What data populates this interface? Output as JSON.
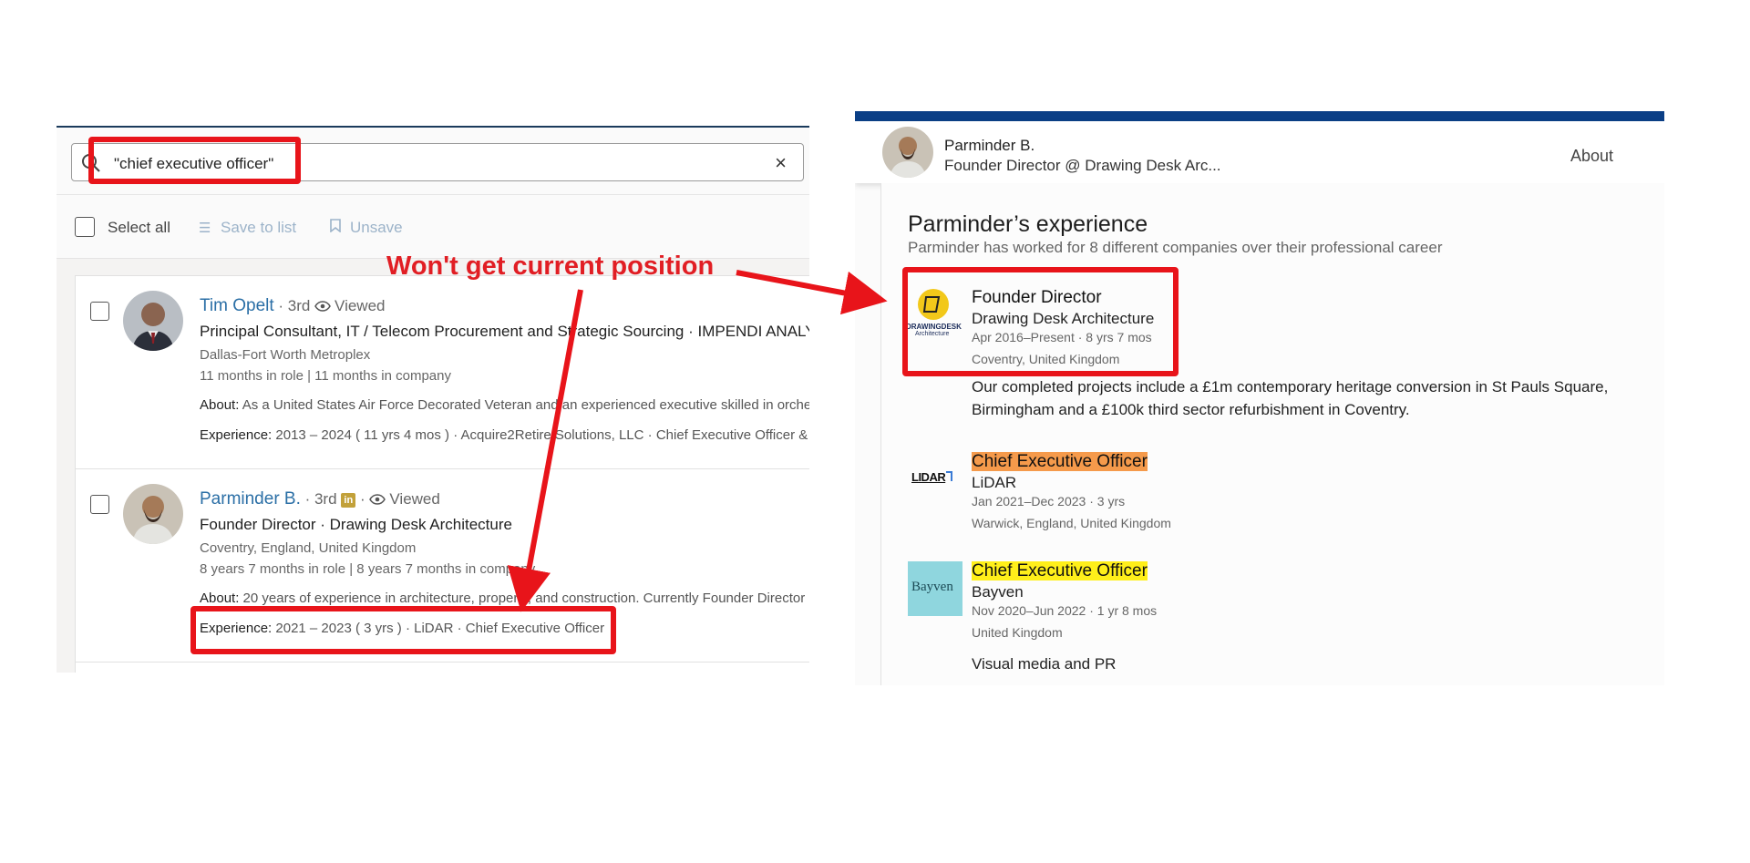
{
  "search": {
    "query": "\"chief executive officer\"",
    "clear_icon": "×"
  },
  "bulk_actions": {
    "select_all_label": "Select all",
    "save_to_list_label": "Save to list",
    "unsave_label": "Unsave"
  },
  "results": [
    {
      "name": "Tim Opelt",
      "degree": " · 3rd ",
      "viewed_label": "Viewed",
      "title": "Principal Consultant, IT / Telecom Procurement and Strategic Sourcing · IMPENDI ANALYTICS",
      "location": "Dallas-Fort Worth Metroplex",
      "tenure": "11 months in role | 11 months in company",
      "about_label": "About:",
      "about_text": " As a United States Air Force Decorated Veteran and an experienced executive skilled in orchestrating",
      "experience_label": "Experience:",
      "experience_text": " 2013 – 2024  ( 11 yrs 4 mos ) · Acquire2Retire Solutions, LLC · Chief Executive Officer & Senior"
    },
    {
      "name": "Parminder B.",
      "degree": " · 3rd ",
      "linkedin_badge": "in",
      "viewed_label": "Viewed",
      "title": "Founder Director · Drawing Desk Architecture",
      "location": "Coventry, England, United Kingdom",
      "tenure": "8 years 7 months in role | 8 years 7 months in company",
      "about_label": "About:",
      "about_text": " 20 years of experience in architecture, property, and construction. Currently Founder Director of",
      "experience_label": "Experience:",
      "experience_text": " 2021 – 2023  ( 3 yrs ) · LiDAR · Chief Executive Officer"
    }
  ],
  "profile": {
    "name": "Parminder B.",
    "headline": "Founder Director @ Drawing Desk Arc...",
    "about_tab": "About",
    "experience_title": "Parminder’s experience",
    "experience_subtitle": "Parminder has worked for 8 different companies over their professional career",
    "experiences": [
      {
        "role": "Founder Director",
        "company": "Drawing Desk Architecture",
        "dates": "Apr 2016–Present · 8 yrs 7 mos",
        "place": "Coventry, United Kingdom",
        "description": "Our completed projects include a £1m contemporary heritage conversion in St Pauls Square, Birmingham and a £100k third sector refurbishment in Coventry.",
        "logo_text_1": "DRAWINGDESK",
        "logo_text_2": "Architecture"
      },
      {
        "role": "Chief Executive Officer",
        "company": "LiDAR",
        "dates": "Jan 2021–Dec 2023 · 3 yrs",
        "place": "Warwick, England, United Kingdom",
        "logo_text": "LIDAR"
      },
      {
        "role": "Chief Executive Officer",
        "company": "Bayven",
        "dates": "Nov 2020–Jun 2022 · 1 yr 8 mos",
        "place": "United Kingdom",
        "description": "Visual media and PR",
        "logo_text": "Bayven"
      }
    ]
  },
  "annotation": {
    "callout": "Won't get current position",
    "color": "#e8141a"
  },
  "colors": {
    "link_blue": "#2b6fa6",
    "header_navy": "#0b3f86",
    "highlight_orange": "#f59a4b",
    "highlight_yellow": "#ffef1a"
  }
}
